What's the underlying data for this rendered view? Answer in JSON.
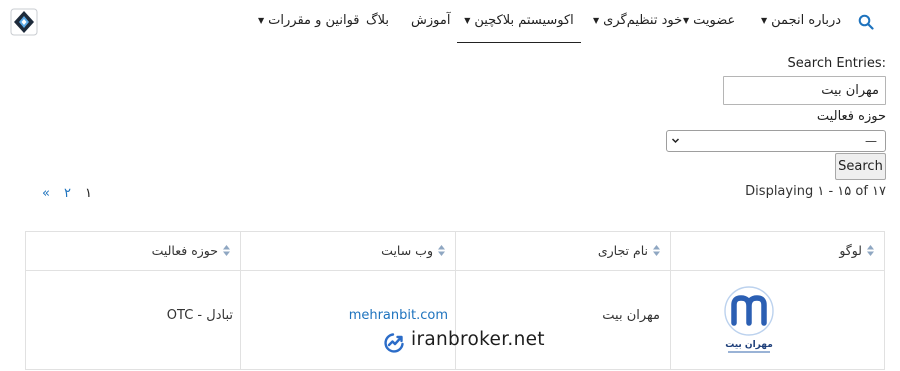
{
  "header": {
    "nav": [
      {
        "label": "درباره انجمن",
        "has_dropdown": true
      },
      {
        "label": "عضویت",
        "has_dropdown": true
      },
      {
        "label": "خود تنظیم‌گری",
        "has_dropdown": true
      },
      {
        "label": "اکوسیستم بلاکچین",
        "has_dropdown": true,
        "active": true
      },
      {
        "label": "آموزش",
        "has_dropdown": false
      },
      {
        "label": "بلاگ",
        "has_dropdown": false
      },
      {
        "label": "قوانین و مقررات",
        "has_dropdown": true
      }
    ],
    "accent_color": "#1e73be"
  },
  "form": {
    "search_label": "Search Entries:",
    "search_value": "مهران بیت",
    "field_label": "حوزه فعالیت",
    "select_value": "—",
    "search_button": "Search"
  },
  "pagination": {
    "pages": [
      "۱",
      "۲",
      "«"
    ],
    "current": "۱"
  },
  "display_info": "Displaying ۱ - ۱۵ of ۱۷",
  "table": {
    "columns": [
      "لوگو",
      "نام تجاری",
      "وب سایت",
      "حوزه فعالیت"
    ],
    "rows": [
      {
        "logo_text": "مهران بیت",
        "brand": "مهران بیت",
        "website": "mehranbit.com",
        "field": "تبادل - OTC"
      }
    ]
  },
  "watermark": "iranbroker.net"
}
